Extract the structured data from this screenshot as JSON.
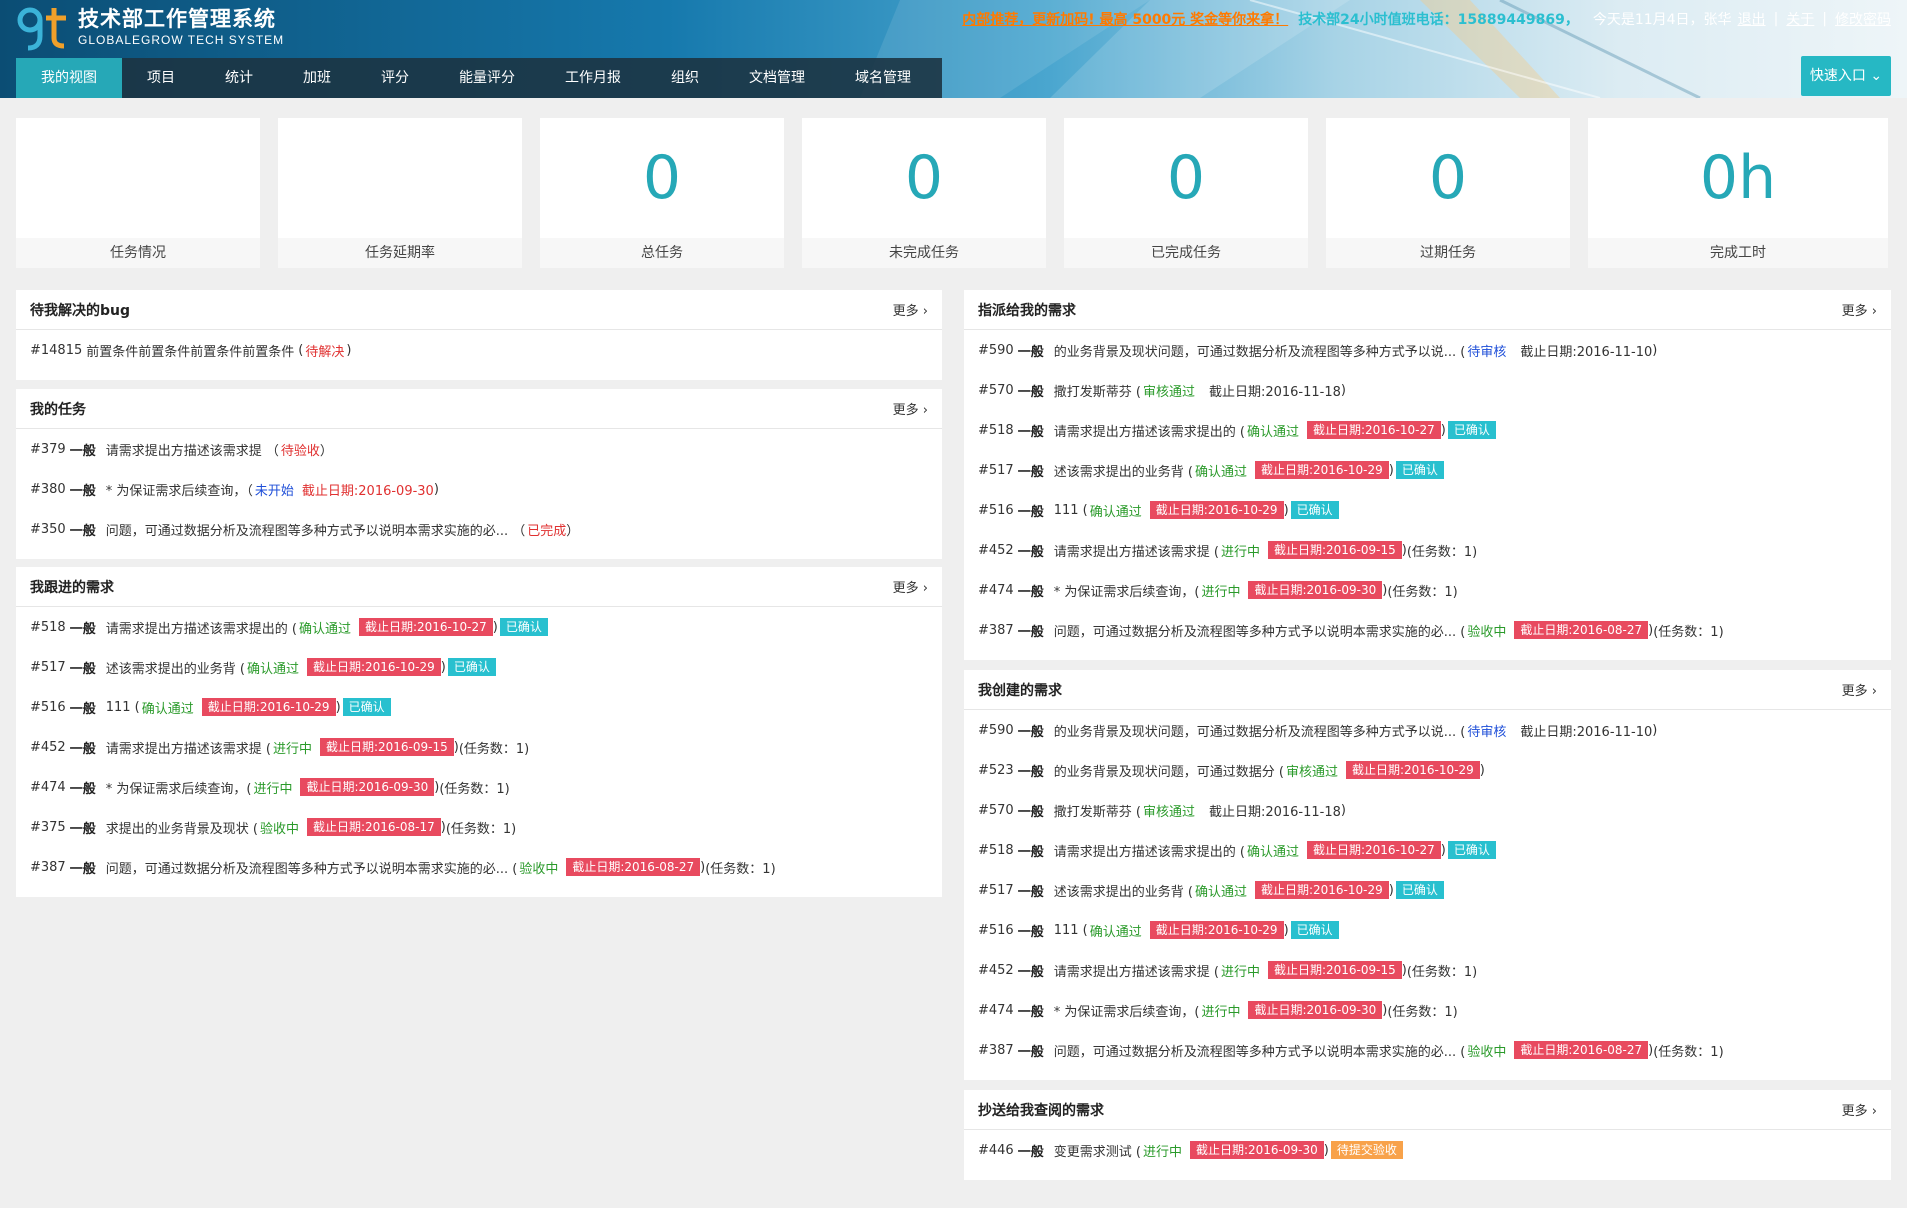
{
  "app": {
    "title": "技术部工作管理系统",
    "subtitle": "GLOBALEGROW TECH SYSTEM"
  },
  "topbar": {
    "promo": "内部推荐，更新加码! 最高 5000元 奖金等你来拿！",
    "hotline": "技术部24小时值班电话：15889449869，",
    "today": "今天是11月4日，张华",
    "logout": "退出",
    "follow": "关于",
    "change_password": "修改密码",
    "sep": "|"
  },
  "nav": [
    "我的视图",
    "项目",
    "统计",
    "加班",
    "评分",
    "能量评分",
    "工作月报",
    "组织",
    "文档管理",
    "域名管理"
  ],
  "quick_entry": "快速入口 ⌄",
  "stats": [
    {
      "value": "",
      "label": "任务情况"
    },
    {
      "value": "",
      "label": "任务延期率"
    },
    {
      "value": "0",
      "label": "总任务"
    },
    {
      "value": "0",
      "label": "未完成任务"
    },
    {
      "value": "0",
      "label": "已完成任务"
    },
    {
      "value": "0",
      "label": "过期任务"
    },
    {
      "value": "0h",
      "label": "完成工时"
    }
  ],
  "more_label": "更多 ›",
  "panels": {
    "bugs": {
      "title": "待我解决的bug",
      "rows": [
        {
          "id": "#14815",
          "priority": "",
          "title": "前置条件前置条件前置条件前置条件",
          "status": "待解决",
          "status_color": "red",
          "paren": true
        }
      ]
    },
    "my_tasks": {
      "title": "我的任务",
      "rows": [
        {
          "id": "#379",
          "priority": "一般",
          "title": "请需求提出方描述该需求提 （",
          "status": "待验收",
          "status_color": "red",
          "close": "）"
        },
        {
          "id": "#380",
          "priority": "一般",
          "title": "* 为保证需求后续查询，（",
          "status": "未开始",
          "status_color": "blue",
          "deadline_red": "截止日期:2016-09-30",
          "close": ")"
        },
        {
          "id": "#350",
          "priority": "一般",
          "title": "问题，可通过数据分析及流程图等多种方式予以说明本需求实施的必... （",
          "status": "已完成",
          "status_color": "red",
          "close": "）"
        }
      ]
    },
    "following": {
      "title": "我跟进的需求",
      "rows": [
        {
          "id": "#518",
          "priority": "一般",
          "title": "请需求提出方描述该需求提出的 (",
          "status": "确认通过",
          "status_color": "green",
          "tag": "截止日期:2016-10-27",
          "close": ")",
          "tag2": "已确认",
          "tag2_type": "cyan"
        },
        {
          "id": "#517",
          "priority": "一般",
          "title": "述该需求提出的业务背 (",
          "status": "确认通过",
          "status_color": "green",
          "tag": "截止日期:2016-10-29",
          "close": ")",
          "tag2": "已确认",
          "tag2_type": "cyan"
        },
        {
          "id": "#516",
          "priority": "一般",
          "title": "111 (",
          "status": "确认通过",
          "status_color": "green",
          "tag": "截止日期:2016-10-29",
          "close": ")",
          "tag2": "已确认",
          "tag2_type": "cyan"
        },
        {
          "id": "#452",
          "priority": "一般",
          "title": "请需求提出方描述该需求提 (",
          "status": "进行中",
          "status_color": "green",
          "tag": "截止日期:2016-09-15",
          "close": ")",
          "tail": "(任务数：1)"
        },
        {
          "id": "#474",
          "priority": "一般",
          "title": "* 为保证需求后续查询，(",
          "status": "进行中",
          "status_color": "green",
          "tag": "截止日期:2016-09-30",
          "close": ")",
          "tail": "(任务数：1)"
        },
        {
          "id": "#375",
          "priority": "一般",
          "title": "求提出的业务背景及现状 (",
          "status": "验收中",
          "status_color": "green",
          "tag": "截止日期:2016-08-17",
          "close": ")",
          "tail": "(任务数：1)"
        },
        {
          "id": "#387",
          "priority": "一般",
          "title": "问题，可通过数据分析及流程图等多种方式予以说明本需求实施的必... (",
          "status": "验收中",
          "status_color": "green",
          "tag": "截止日期:2016-08-27",
          "close": ")",
          "tail": "(任务数：1)"
        }
      ]
    },
    "assigned": {
      "title": "指派给我的需求",
      "rows": [
        {
          "id": "#590",
          "priority": "一般",
          "title": "的业务背景及现状问题，可通过数据分析及流程图等多种方式予以说... (",
          "status": "待审核",
          "status_color": "blue",
          "deadline": "截止日期:2016-11-10",
          "close": ")"
        },
        {
          "id": "#570",
          "priority": "一般",
          "title": "撒打发斯蒂芬 (",
          "status": "审核通过",
          "status_color": "green",
          "deadline": "截止日期:2016-11-18",
          "close": ")"
        },
        {
          "id": "#518",
          "priority": "一般",
          "title": "请需求提出方描述该需求提出的 (",
          "status": "确认通过",
          "status_color": "green",
          "tag": "截止日期:2016-10-27",
          "close": ")",
          "tag2": "已确认",
          "tag2_type": "cyan"
        },
        {
          "id": "#517",
          "priority": "一般",
          "title": "述该需求提出的业务背 (",
          "status": "确认通过",
          "status_color": "green",
          "tag": "截止日期:2016-10-29",
          "close": ")",
          "tag2": "已确认",
          "tag2_type": "cyan"
        },
        {
          "id": "#516",
          "priority": "一般",
          "title": "111 (",
          "status": "确认通过",
          "status_color": "green",
          "tag": "截止日期:2016-10-29",
          "close": ")",
          "tag2": "已确认",
          "tag2_type": "cyan"
        },
        {
          "id": "#452",
          "priority": "一般",
          "title": "请需求提出方描述该需求提 (",
          "status": "进行中",
          "status_color": "green",
          "tag": "截止日期:2016-09-15",
          "close": ")",
          "tail": "(任务数：1)"
        },
        {
          "id": "#474",
          "priority": "一般",
          "title": "* 为保证需求后续查询，(",
          "status": "进行中",
          "status_color": "green",
          "tag": "截止日期:2016-09-30",
          "close": ")",
          "tail": "(任务数：1)"
        },
        {
          "id": "#387",
          "priority": "一般",
          "title": "问题，可通过数据分析及流程图等多种方式予以说明本需求实施的必... (",
          "status": "验收中",
          "status_color": "green",
          "tag": "截止日期:2016-08-27",
          "close": ")",
          "tail": "(任务数：1)"
        }
      ]
    },
    "created": {
      "title": "我创建的需求",
      "rows": [
        {
          "id": "#590",
          "priority": "一般",
          "title": "的业务背景及现状问题，可通过数据分析及流程图等多种方式予以说... (",
          "status": "待审核",
          "status_color": "blue",
          "deadline": "截止日期:2016-11-10",
          "close": ")"
        },
        {
          "id": "#523",
          "priority": "一般",
          "title": "的业务背景及现状问题，可通过数据分 (",
          "status": "审核通过",
          "status_color": "green",
          "tag": "截止日期:2016-10-29",
          "close": ")"
        },
        {
          "id": "#570",
          "priority": "一般",
          "title": "撒打发斯蒂芬 (",
          "status": "审核通过",
          "status_color": "green",
          "deadline": "截止日期:2016-11-18",
          "close": ")"
        },
        {
          "id": "#518",
          "priority": "一般",
          "title": "请需求提出方描述该需求提出的 (",
          "status": "确认通过",
          "status_color": "green",
          "tag": "截止日期:2016-10-27",
          "close": ")",
          "tag2": "已确认",
          "tag2_type": "cyan"
        },
        {
          "id": "#517",
          "priority": "一般",
          "title": "述该需求提出的业务背 (",
          "status": "确认通过",
          "status_color": "green",
          "tag": "截止日期:2016-10-29",
          "close": ")",
          "tag2": "已确认",
          "tag2_type": "cyan"
        },
        {
          "id": "#516",
          "priority": "一般",
          "title": "111 (",
          "status": "确认通过",
          "status_color": "green",
          "tag": "截止日期:2016-10-29",
          "close": ")",
          "tag2": "已确认",
          "tag2_type": "cyan"
        },
        {
          "id": "#452",
          "priority": "一般",
          "title": "请需求提出方描述该需求提 (",
          "status": "进行中",
          "status_color": "green",
          "tag": "截止日期:2016-09-15",
          "close": ")",
          "tail": "(任务数：1)"
        },
        {
          "id": "#474",
          "priority": "一般",
          "title": "* 为保证需求后续查询，(",
          "status": "进行中",
          "status_color": "green",
          "tag": "截止日期:2016-09-30",
          "close": ")",
          "tail": "(任务数：1)"
        },
        {
          "id": "#387",
          "priority": "一般",
          "title": "问题，可通过数据分析及流程图等多种方式予以说明本需求实施的必... (",
          "status": "验收中",
          "status_color": "green",
          "tag": "截止日期:2016-08-27",
          "close": ")",
          "tail": "(任务数：1)"
        }
      ]
    },
    "cc": {
      "title": "抄送给我查阅的需求",
      "rows": [
        {
          "id": "#446",
          "priority": "一般",
          "title": "变更需求测试 (",
          "status": "进行中",
          "status_color": "green",
          "tag": "截止日期:2016-09-30",
          "close": ")",
          "tag2": "待提交验收",
          "tag2_type": "orange"
        }
      ]
    }
  },
  "colors": {
    "accent": "#26a8b7",
    "tag_red": "#e84a5f",
    "tag_cyan": "#28c0cf",
    "tag_orange": "#f8a24a",
    "status_green": "#2a9a2a",
    "status_red": "#e03030",
    "status_blue": "#1f4fd8",
    "promo": "#ff7a00"
  }
}
